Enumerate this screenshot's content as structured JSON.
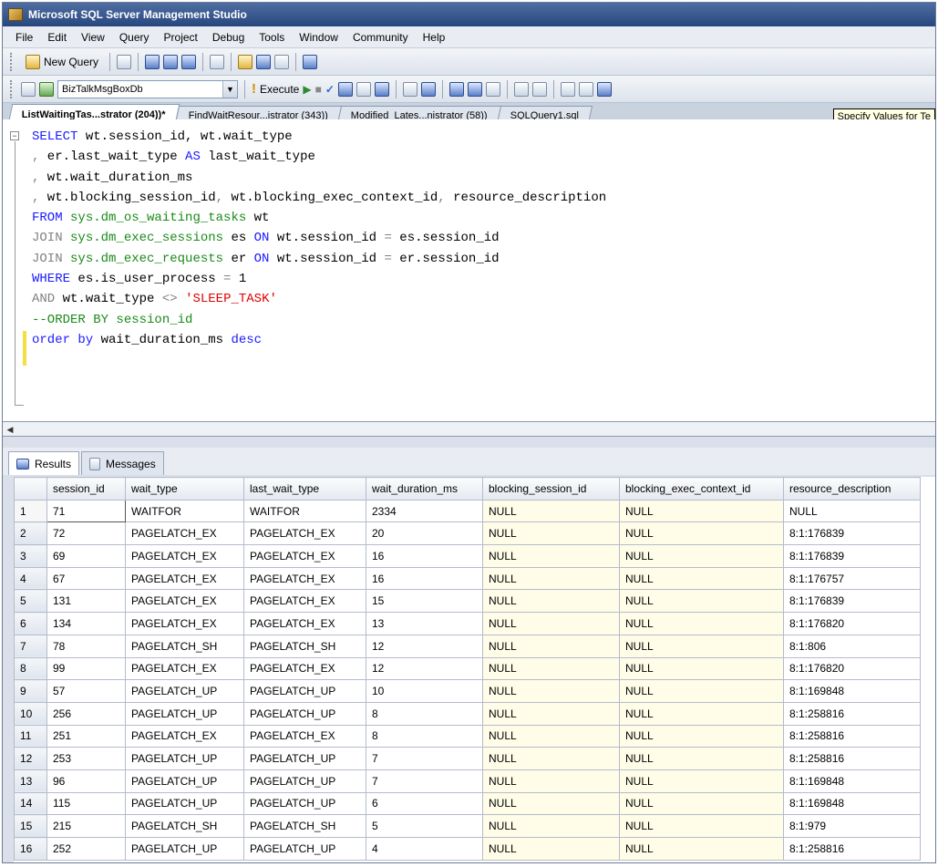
{
  "window": {
    "title": "Microsoft SQL Server Management Studio"
  },
  "menu": [
    "File",
    "Edit",
    "View",
    "Query",
    "Project",
    "Debug",
    "Tools",
    "Window",
    "Community",
    "Help"
  ],
  "toolbar": {
    "new_query": "New Query",
    "database": "BizTalkMsgBoxDb",
    "execute": "Execute"
  },
  "tabs": [
    {
      "label": "ListWaitingTas...strator (204))*"
    },
    {
      "label": "FindWaitResour...istrator (343))"
    },
    {
      "label": "Modified_Lates...nistrator (58))"
    },
    {
      "label": "SQLQuery1.sql"
    }
  ],
  "tooltip": "Specify Values for Te",
  "results_tabs": {
    "results": "Results",
    "messages": "Messages"
  },
  "grid": {
    "columns": [
      "session_id",
      "wait_type",
      "last_wait_type",
      "wait_duration_ms",
      "blocking_session_id",
      "blocking_exec_context_id",
      "resource_description"
    ],
    "rows": [
      [
        "1",
        "71",
        "WAITFOR",
        "WAITFOR",
        "2334",
        "NULL",
        "NULL",
        "NULL"
      ],
      [
        "2",
        "72",
        "PAGELATCH_EX",
        "PAGELATCH_EX",
        "20",
        "NULL",
        "NULL",
        "8:1:176839"
      ],
      [
        "3",
        "69",
        "PAGELATCH_EX",
        "PAGELATCH_EX",
        "16",
        "NULL",
        "NULL",
        "8:1:176839"
      ],
      [
        "4",
        "67",
        "PAGELATCH_EX",
        "PAGELATCH_EX",
        "16",
        "NULL",
        "NULL",
        "8:1:176757"
      ],
      [
        "5",
        "131",
        "PAGELATCH_EX",
        "PAGELATCH_EX",
        "15",
        "NULL",
        "NULL",
        "8:1:176839"
      ],
      [
        "6",
        "134",
        "PAGELATCH_EX",
        "PAGELATCH_EX",
        "13",
        "NULL",
        "NULL",
        "8:1:176820"
      ],
      [
        "7",
        "78",
        "PAGELATCH_SH",
        "PAGELATCH_SH",
        "12",
        "NULL",
        "NULL",
        "8:1:806"
      ],
      [
        "8",
        "99",
        "PAGELATCH_EX",
        "PAGELATCH_EX",
        "12",
        "NULL",
        "NULL",
        "8:1:176820"
      ],
      [
        "9",
        "57",
        "PAGELATCH_UP",
        "PAGELATCH_UP",
        "10",
        "NULL",
        "NULL",
        "8:1:169848"
      ],
      [
        "10",
        "256",
        "PAGELATCH_UP",
        "PAGELATCH_UP",
        "8",
        "NULL",
        "NULL",
        "8:1:258816"
      ],
      [
        "11",
        "251",
        "PAGELATCH_EX",
        "PAGELATCH_EX",
        "8",
        "NULL",
        "NULL",
        "8:1:258816"
      ],
      [
        "12",
        "253",
        "PAGELATCH_UP",
        "PAGELATCH_UP",
        "7",
        "NULL",
        "NULL",
        "8:1:258816"
      ],
      [
        "13",
        "96",
        "PAGELATCH_UP",
        "PAGELATCH_UP",
        "7",
        "NULL",
        "NULL",
        "8:1:169848"
      ],
      [
        "14",
        "115",
        "PAGELATCH_UP",
        "PAGELATCH_UP",
        "6",
        "NULL",
        "NULL",
        "8:1:169848"
      ],
      [
        "15",
        "215",
        "PAGELATCH_SH",
        "PAGELATCH_SH",
        "5",
        "NULL",
        "NULL",
        "8:1:979"
      ],
      [
        "16",
        "252",
        "PAGELATCH_UP",
        "PAGELATCH_UP",
        "4",
        "NULL",
        "NULL",
        "8:1:258816"
      ]
    ]
  }
}
